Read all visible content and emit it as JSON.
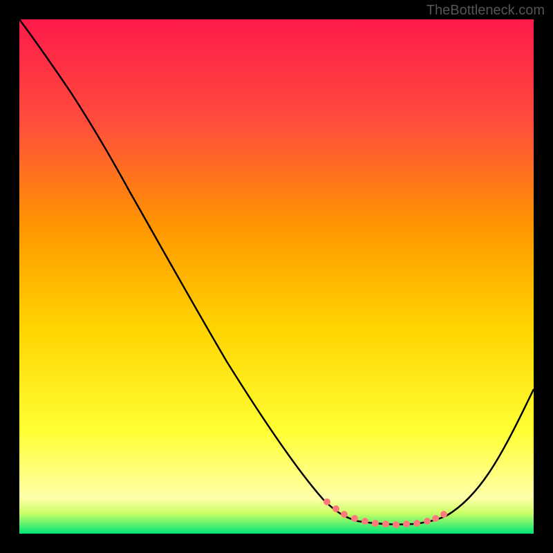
{
  "watermark": "TheBottleneck.com",
  "chart_data": {
    "type": "line",
    "title": "",
    "xlabel": "",
    "ylabel": "",
    "xlim": [
      0,
      100
    ],
    "ylim": [
      0,
      100
    ],
    "gradient_colors": {
      "top": "#ff1a4a",
      "middle_upper": "#ff7a00",
      "middle": "#ffd400",
      "middle_lower": "#ffff66",
      "bottom": "#00e676"
    },
    "series": [
      {
        "name": "bottleneck-curve",
        "type": "line",
        "color": "#000000",
        "points": [
          {
            "x": 0,
            "y": 100
          },
          {
            "x": 5,
            "y": 95
          },
          {
            "x": 10,
            "y": 88
          },
          {
            "x": 15,
            "y": 80
          },
          {
            "x": 20,
            "y": 70
          },
          {
            "x": 25,
            "y": 60
          },
          {
            "x": 30,
            "y": 50
          },
          {
            "x": 35,
            "y": 40
          },
          {
            "x": 40,
            "y": 30
          },
          {
            "x": 45,
            "y": 22
          },
          {
            "x": 50,
            "y": 15
          },
          {
            "x": 55,
            "y": 8
          },
          {
            "x": 60,
            "y": 4
          },
          {
            "x": 65,
            "y": 2
          },
          {
            "x": 70,
            "y": 2
          },
          {
            "x": 75,
            "y": 2
          },
          {
            "x": 80,
            "y": 3
          },
          {
            "x": 85,
            "y": 6
          },
          {
            "x": 90,
            "y": 12
          },
          {
            "x": 95,
            "y": 20
          },
          {
            "x": 100,
            "y": 28
          }
        ]
      },
      {
        "name": "highlighted-points",
        "type": "scatter",
        "color": "#ff6b6b",
        "points": [
          {
            "x": 60,
            "y": 4
          },
          {
            "x": 63,
            "y": 3
          },
          {
            "x": 66,
            "y": 2.5
          },
          {
            "x": 68,
            "y": 2
          },
          {
            "x": 70,
            "y": 2
          },
          {
            "x": 72,
            "y": 2
          },
          {
            "x": 74,
            "y": 2
          },
          {
            "x": 76,
            "y": 2
          },
          {
            "x": 78,
            "y": 2.5
          },
          {
            "x": 80,
            "y": 3
          }
        ]
      }
    ]
  }
}
